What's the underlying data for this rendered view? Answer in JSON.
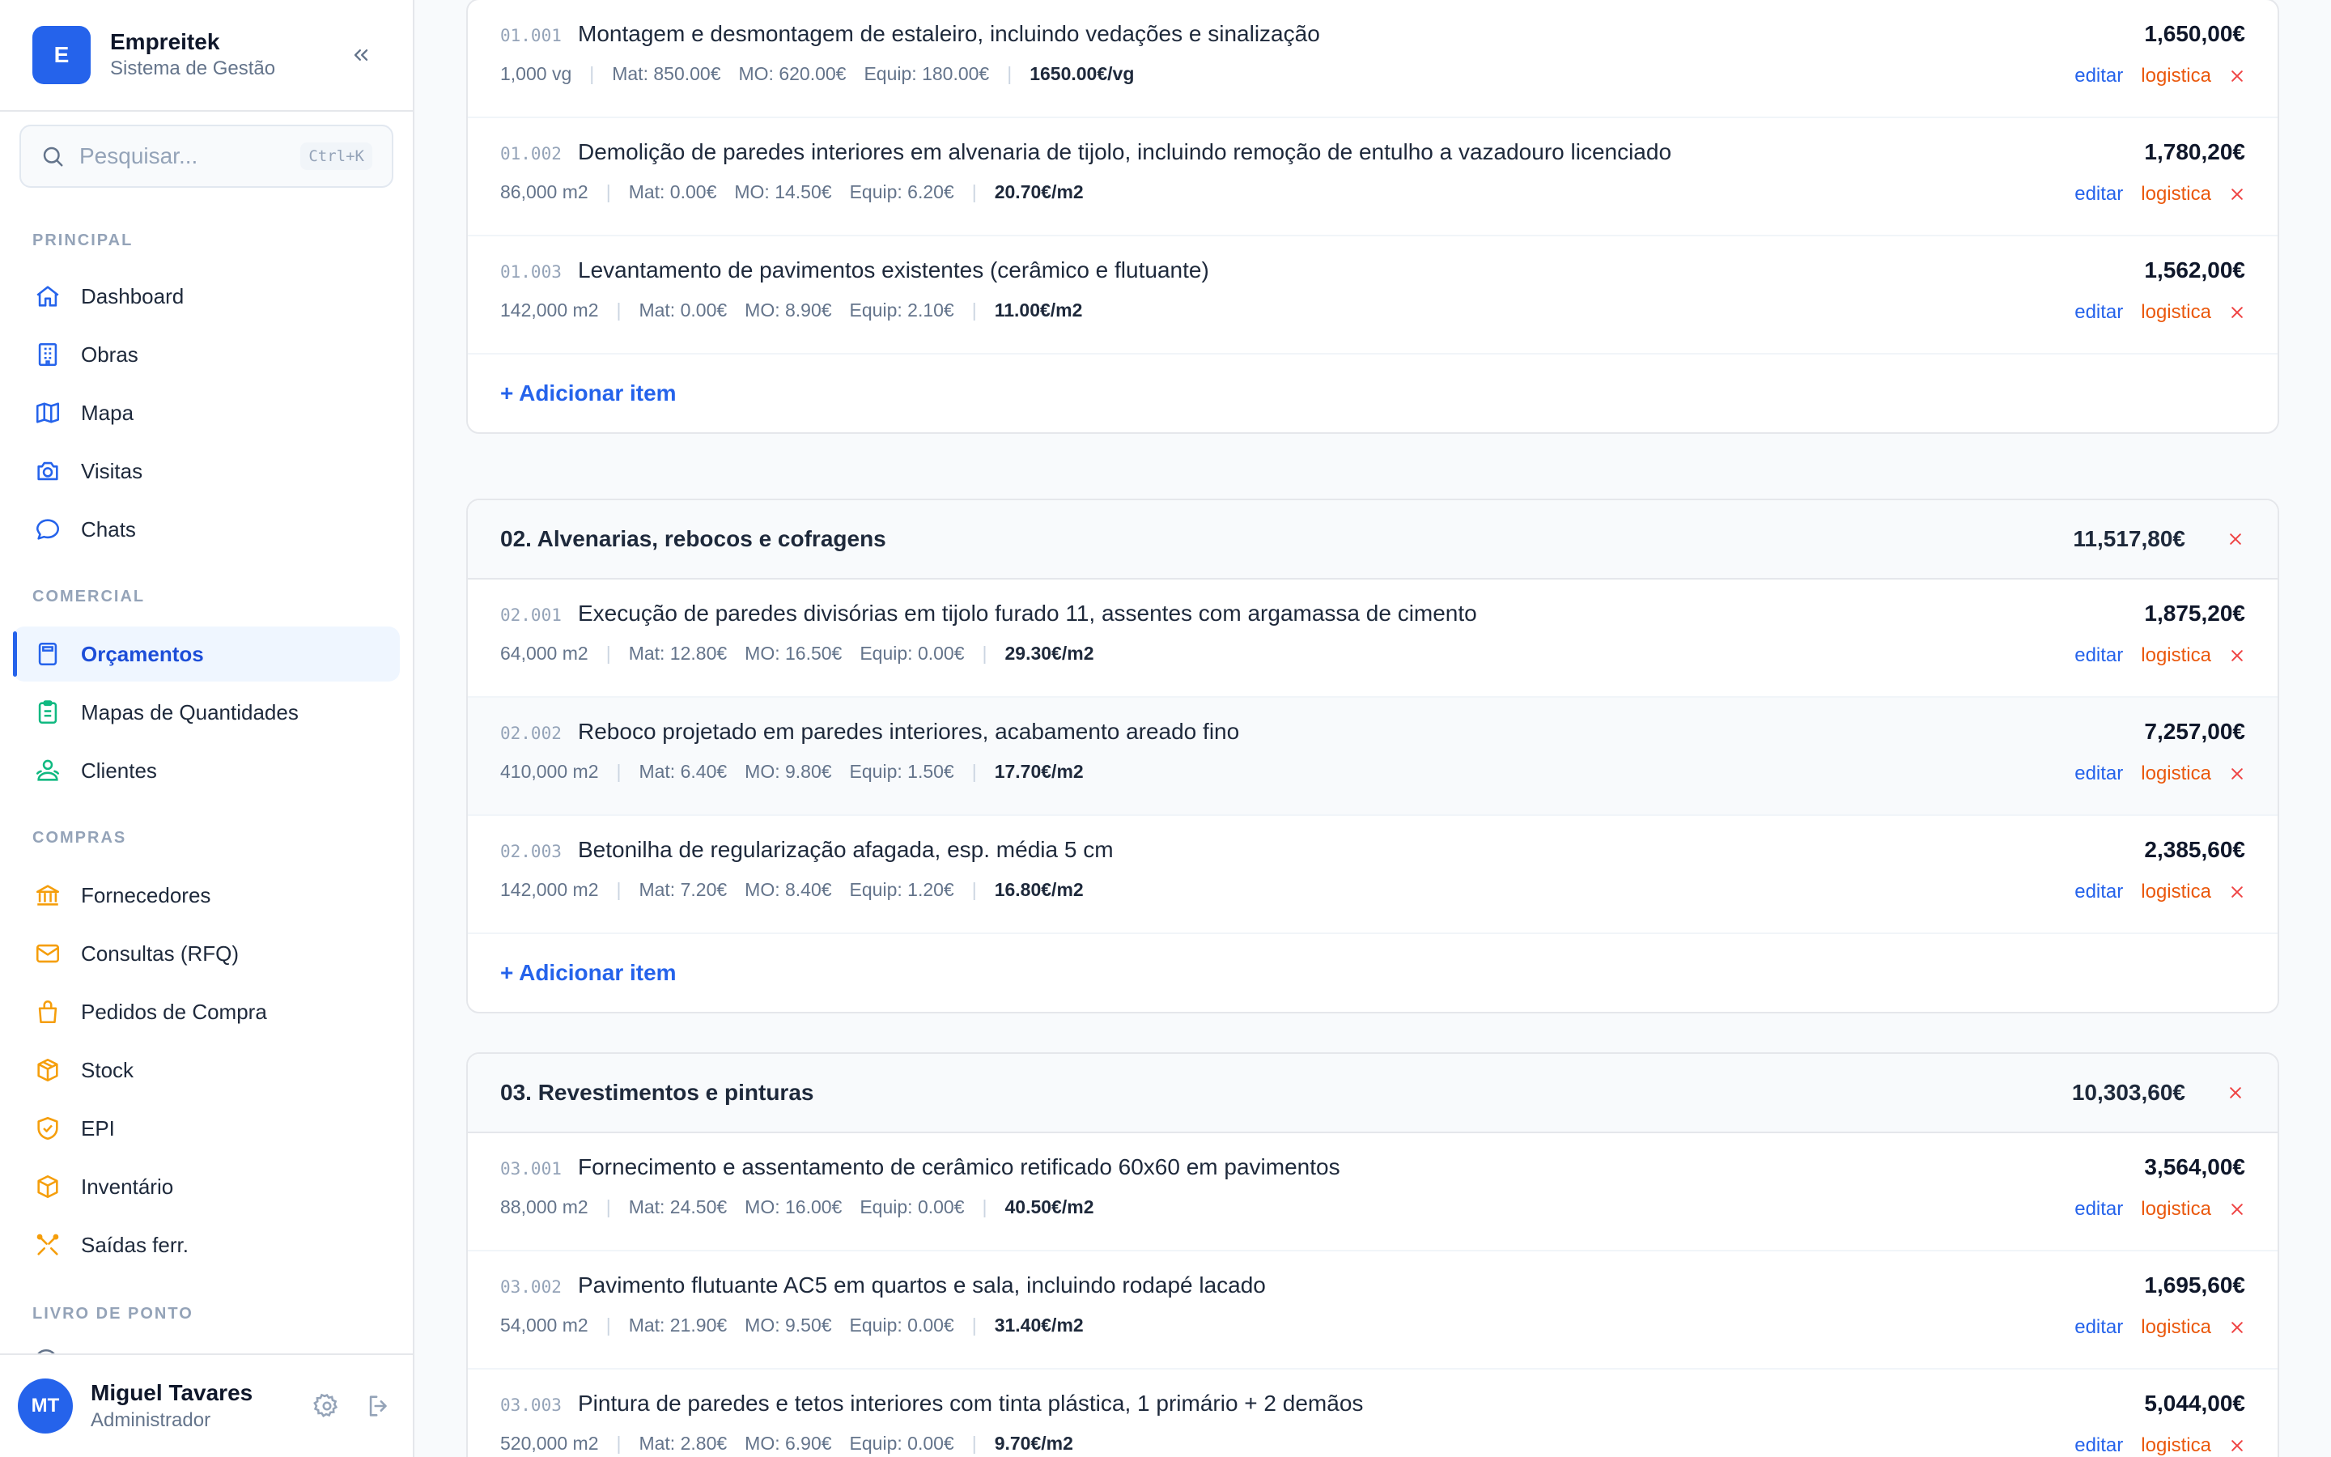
{
  "brand": {
    "logo_letter": "E",
    "name": "Empreitek",
    "subtitle": "Sistema de Gestão"
  },
  "search": {
    "placeholder": "Pesquisar...",
    "shortcut": "Ctrl+K"
  },
  "nav": {
    "principal": {
      "label": "PRINCIPAL",
      "items": [
        {
          "label": "Dashboard",
          "icon": "home-icon"
        },
        {
          "label": "Obras",
          "icon": "building-icon"
        },
        {
          "label": "Mapa",
          "icon": "map-icon"
        },
        {
          "label": "Visitas",
          "icon": "camera-icon"
        },
        {
          "label": "Chats",
          "icon": "chat-icon"
        }
      ]
    },
    "comercial": {
      "label": "COMERCIAL",
      "items": [
        {
          "label": "Orçamentos",
          "icon": "calculator-icon",
          "active": true
        },
        {
          "label": "Mapas de Quantidades",
          "icon": "clipboard-icon"
        },
        {
          "label": "Clientes",
          "icon": "users-icon"
        }
      ]
    },
    "compras": {
      "label": "COMPRAS",
      "items": [
        {
          "label": "Fornecedores",
          "icon": "bank-icon"
        },
        {
          "label": "Consultas (RFQ)",
          "icon": "mail-icon"
        },
        {
          "label": "Pedidos de Compra",
          "icon": "bag-icon"
        },
        {
          "label": "Stock",
          "icon": "box-icon"
        },
        {
          "label": "EPI",
          "icon": "shield-check-icon"
        },
        {
          "label": "Inventário",
          "icon": "cube-icon"
        },
        {
          "label": "Saídas ferr.",
          "icon": "tools-icon"
        }
      ]
    },
    "livro": {
      "label": "LIVRO DE PONTO"
    }
  },
  "user": {
    "initials": "MT",
    "name": "Miguel Tavares",
    "role": "Administrador"
  },
  "actions": {
    "edit": "editar",
    "logistics": "logistica",
    "add_item": "+ Adicionar item"
  },
  "chapters": [
    {
      "title": "",
      "total": "",
      "items": [
        {
          "code": "01.001",
          "desc": "Montagem e desmontagem de estaleiro, incluindo vedações e sinalização",
          "qty": "1,000 vg",
          "mat": "Mat: 850.00€",
          "mo": "MO: 620.00€",
          "equip": "Equip: 180.00€",
          "unit_price": "1650.00€/vg",
          "total": "1,650,00€"
        },
        {
          "code": "01.002",
          "desc": "Demolição de paredes interiores em alvenaria de tijolo, incluindo remoção de entulho a vazadouro licenciado",
          "qty": "86,000 m2",
          "mat": "Mat: 0.00€",
          "mo": "MO: 14.50€",
          "equip": "Equip: 6.20€",
          "unit_price": "20.70€/m2",
          "total": "1,780,20€"
        },
        {
          "code": "01.003",
          "desc": "Levantamento de pavimentos existentes (cerâmico e flutuante)",
          "qty": "142,000 m2",
          "mat": "Mat: 0.00€",
          "mo": "MO: 8.90€",
          "equip": "Equip: 2.10€",
          "unit_price": "11.00€/m2",
          "total": "1,562,00€"
        }
      ]
    },
    {
      "title": "02. Alvenarias, rebocos e cofragens",
      "total": "11,517,80€",
      "items": [
        {
          "code": "02.001",
          "desc": "Execução de paredes divisórias em tijolo furado 11, assentes com argamassa de cimento",
          "qty": "64,000 m2",
          "mat": "Mat: 12.80€",
          "mo": "MO: 16.50€",
          "equip": "Equip: 0.00€",
          "unit_price": "29.30€/m2",
          "total": "1,875,20€"
        },
        {
          "code": "02.002",
          "desc": "Reboco projetado em paredes interiores, acabamento areado fino",
          "qty": "410,000 m2",
          "mat": "Mat: 6.40€",
          "mo": "MO: 9.80€",
          "equip": "Equip: 1.50€",
          "unit_price": "17.70€/m2",
          "total": "7,257,00€"
        },
        {
          "code": "02.003",
          "desc": "Betonilha de regularização afagada, esp. média 5 cm",
          "qty": "142,000 m2",
          "mat": "Mat: 7.20€",
          "mo": "MO: 8.40€",
          "equip": "Equip: 1.20€",
          "unit_price": "16.80€/m2",
          "total": "2,385,60€"
        }
      ]
    },
    {
      "title": "03. Revestimentos e pinturas",
      "total": "10,303,60€",
      "items": [
        {
          "code": "03.001",
          "desc": "Fornecimento e assentamento de cerâmico retificado 60x60 em pavimentos",
          "qty": "88,000 m2",
          "mat": "Mat: 24.50€",
          "mo": "MO: 16.00€",
          "equip": "Equip: 0.00€",
          "unit_price": "40.50€/m2",
          "total": "3,564,00€"
        },
        {
          "code": "03.002",
          "desc": "Pavimento flutuante AC5 em quartos e sala, incluindo rodapé lacado",
          "qty": "54,000 m2",
          "mat": "Mat: 21.90€",
          "mo": "MO: 9.50€",
          "equip": "Equip: 0.00€",
          "unit_price": "31.40€/m2",
          "total": "1,695,60€"
        },
        {
          "code": "03.003",
          "desc": "Pintura de paredes e tetos interiores com tinta plástica, 1 primário + 2 demãos",
          "qty": "520,000 m2",
          "mat": "Mat: 2.80€",
          "mo": "MO: 6.90€",
          "equip": "Equip: 0.00€",
          "unit_price": "9.70€/m2",
          "total": "5,044,00€"
        }
      ]
    }
  ],
  "colors": {
    "accent": "#2563eb",
    "logistics": "#ea580c",
    "delete": "#ef4444"
  }
}
